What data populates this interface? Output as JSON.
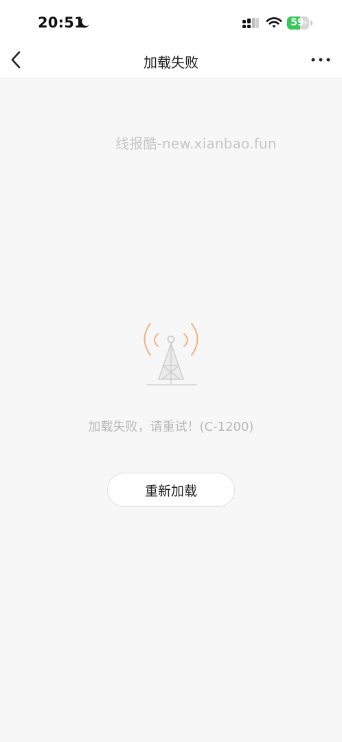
{
  "status_bar": {
    "time": "20:51",
    "battery_level": "59",
    "battery_fraction": 0.59,
    "icons": [
      "moon-icon",
      "cellular-signal-icon",
      "wifi-icon",
      "battery-icon",
      "charging-bolt-icon"
    ]
  },
  "nav": {
    "title": "加载失败",
    "back_icon": "chevron-left-icon",
    "more_icon": "more-dots-icon"
  },
  "watermark": "线报酷-new.xianbao.fun",
  "error": {
    "icon": "signal-tower-icon",
    "message": "加载失败，请重试！(C-1200)",
    "retry_label": "重新加载"
  },
  "colors": {
    "background": "#f7f7f7",
    "header": "#ffffff",
    "battery_green": "#34c759",
    "signal_waves": "#f1b183",
    "muted_text": "#b8b8b8"
  }
}
